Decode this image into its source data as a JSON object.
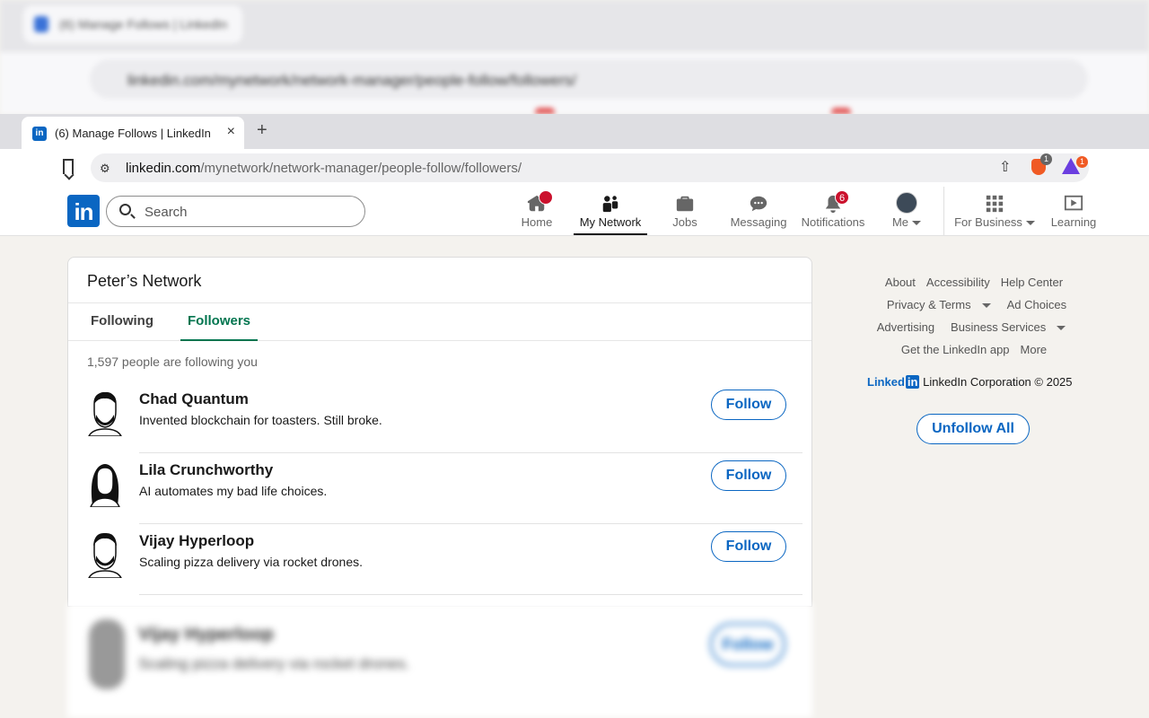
{
  "browser": {
    "tab_title": "(6) Manage Follows | LinkedIn",
    "tab_close": "×",
    "new_tab": "+",
    "url_host": "linkedin.com",
    "url_path": "/mynetwork/network-manager/people-follow/followers/",
    "brave_badge": "1",
    "rewards_badge": "1",
    "ghost_tab_title": "(6) Manage Follows | LinkedIn",
    "ghost_url": "linkedin.com/mynetwork/network-manager/people-follow/followers/"
  },
  "header": {
    "logo": "in",
    "search_placeholder": "Search",
    "nav": {
      "home": "Home",
      "home_badge": "",
      "my_network": "My Network",
      "jobs": "Jobs",
      "messaging": "Messaging",
      "notifications": "Notifications",
      "notifications_badge": "6",
      "me": "Me",
      "for_business": "For Business",
      "learning": "Learning"
    }
  },
  "main": {
    "title": "Peter’s Network",
    "tabs": {
      "following": "Following",
      "followers": "Followers"
    },
    "count_text": "1,597 people are following you",
    "followers": [
      {
        "name": "Chad Quantum",
        "headline": "Invented blockchain for toasters. Still broke.",
        "button": "Follow"
      },
      {
        "name": "Lila Crunchworthy",
        "headline": "AI automates my bad life choices.",
        "button": "Follow"
      },
      {
        "name": "Vijay Hyperloop",
        "headline": "Scaling pizza delivery via rocket drones.",
        "button": "Follow"
      }
    ],
    "ghost_row": {
      "name": "Vijay Hyperloop",
      "headline": "Scaling pizza delivery via rocket drones.",
      "button": "Follow"
    }
  },
  "rail": {
    "about": "About",
    "accessibility": "Accessibility",
    "help_center": "Help Center",
    "privacy_terms": "Privacy & Terms",
    "ad_choices": "Ad Choices",
    "advertising": "Advertising",
    "business_services": "Business Services",
    "get_app": "Get the LinkedIn app",
    "more": "More",
    "wordmark": "Linked",
    "wordmark_box": "in",
    "corp": "LinkedIn Corporation © 2025",
    "unfollow_all": "Unfollow All"
  },
  "colors": {
    "brand": "#0a66c2",
    "accent_green": "#01754f",
    "badge_red": "#cb112d"
  },
  "icons": [
    "bookmark-icon",
    "site-settings-icon",
    "share-icon",
    "brave-shield-icon",
    "brave-rewards-icon",
    "search-icon",
    "home-icon",
    "my-network-icon",
    "jobs-icon",
    "messaging-icon",
    "notifications-icon",
    "grid-icon",
    "learning-icon"
  ]
}
